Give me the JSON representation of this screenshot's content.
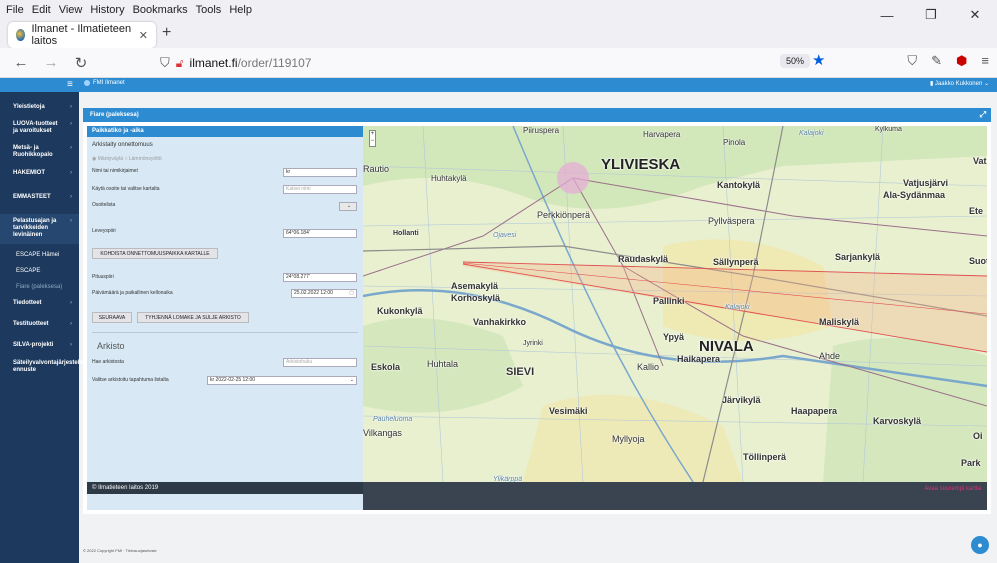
{
  "browser": {
    "menu": [
      "File",
      "Edit",
      "View",
      "History",
      "Bookmarks",
      "Tools",
      "Help"
    ],
    "tab_title": "Ilmanet - Ilmatieteen laitos",
    "url_host": "ilmanet.fi",
    "url_path": "/order/119107",
    "zoom": "50%"
  },
  "app": {
    "brand": "FMI Ilmanet",
    "user": "Jaakko Kukkonen",
    "panel_title": "Fiare (paleksesa)",
    "sidebar": [
      {
        "label": "Yleistietoja",
        "arrow": "›"
      },
      {
        "label": "LUOVA-tuotteet ja varoitukset",
        "arrow": "›"
      },
      {
        "label": "Metsä- ja Ruohikkopalo",
        "arrow": "›"
      },
      {
        "label": "HAKEMIOT",
        "arrow": "›"
      },
      {
        "label": "EMMASTEET",
        "arrow": "›"
      },
      {
        "label": "Pelastusajan ja tarvikkeiden levinäinen",
        "arrow": "›"
      },
      {
        "label": "ESCAPE Hämei",
        "arrow": ""
      },
      {
        "label": "ESCAPE",
        "arrow": ""
      },
      {
        "label": "Fiare (paleksesa)",
        "arrow": ""
      },
      {
        "label": "Tiedotteet",
        "arrow": "›"
      },
      {
        "label": "Testituotteet",
        "arrow": "›"
      },
      {
        "label": "SILVA-projekti",
        "arrow": "›"
      },
      {
        "label": "Säteilyvalvontajärjestelmä, ennuste",
        "arrow": "›"
      }
    ]
  },
  "form": {
    "header": "Paikkatiko ja -aika",
    "arkisto_label": "Arkistaity onnettomuus",
    "radio1": "Mäntyväylä",
    "radio2": "Lämmönsyöttö",
    "fields": {
      "nimi_label": "Nimi tai nimikirjaimet",
      "nimi_value": "kr",
      "osoite_label": "Käytä osoite tai valitse kartalta",
      "osoite_placeholder": "Katsei nimi",
      "osoitelista_label": "Osoitelista",
      "leveys_label": "Leveyspiiri",
      "leveys_value": "64°06.184'",
      "kohdista_btn": "KOHDISTA ONNETTOMUUSPAIKKA KARTALLE",
      "pituus_label": "Pituuspiiri",
      "pituus_value": "24°08.277'",
      "paivamaara_label": "Päivämäärä ja paikallinen kellonaika",
      "paivamaara_value": "25.02.2022 12:00"
    },
    "buttons": {
      "seuraava": "SEURAAVA",
      "tyhjenna": "TYHJENNÄ LOMAKE JA SULJE ARKISTO"
    },
    "arkisto_section": "Arkisto",
    "hae_label": "Hae arkistosta",
    "hae_placeholder": "Arkistohaku",
    "valitse_label": "Valitse arkistoitu tapahtuma listalta",
    "valitse_value": "kr 2022-02-25 12:00",
    "footer": "© Ilmatieteen laitos 2019"
  },
  "map": {
    "labels_big": [
      "YLIVIESKA",
      "NIVALA"
    ],
    "labels_med": [
      "Kantokylä",
      "Pyllväspera",
      "Raudaskylä",
      "Sällynperä",
      "Sarjankylä",
      "Asemakylä",
      "Korhoskylä",
      "Kukonkylä",
      "Vanhakirkko",
      "Pallinki",
      "Ypyä",
      "Maliskylä",
      "Haikapera",
      "Ahde",
      "Eskola",
      "Huhtala",
      "SIEVI",
      "Kallio",
      "Järvikylä",
      "Haapapera",
      "Karvoskylä",
      "Vesimäki",
      "Myllyoja",
      "Töllinperä",
      "Park",
      "Oi",
      "Vatjusjärvi",
      "Ala-Sydänmaa",
      "Ete",
      "Suoti",
      "Vat",
      "Hollanti",
      "Perkkiönperä",
      "Rautio",
      "Huhtakylä",
      "Harvapera",
      "Piiruspera",
      "Kylkuma",
      "Jyrinki",
      "Vilkangas",
      "Pinola"
    ],
    "labels_water": [
      "Kalajoki",
      "Ojavesi",
      "Ylikärppä",
      "Pauheluoma",
      "Kalajoki"
    ],
    "footer_link": "Avaa suurempi kartta"
  },
  "page_footer": "© 2022 Copyright FMI  ·  Tietosuojaseloste",
  "colors": {
    "accent": "#2d8bd1",
    "sidebar": "#1d3a5e",
    "form_bg": "#d8e9f5"
  }
}
